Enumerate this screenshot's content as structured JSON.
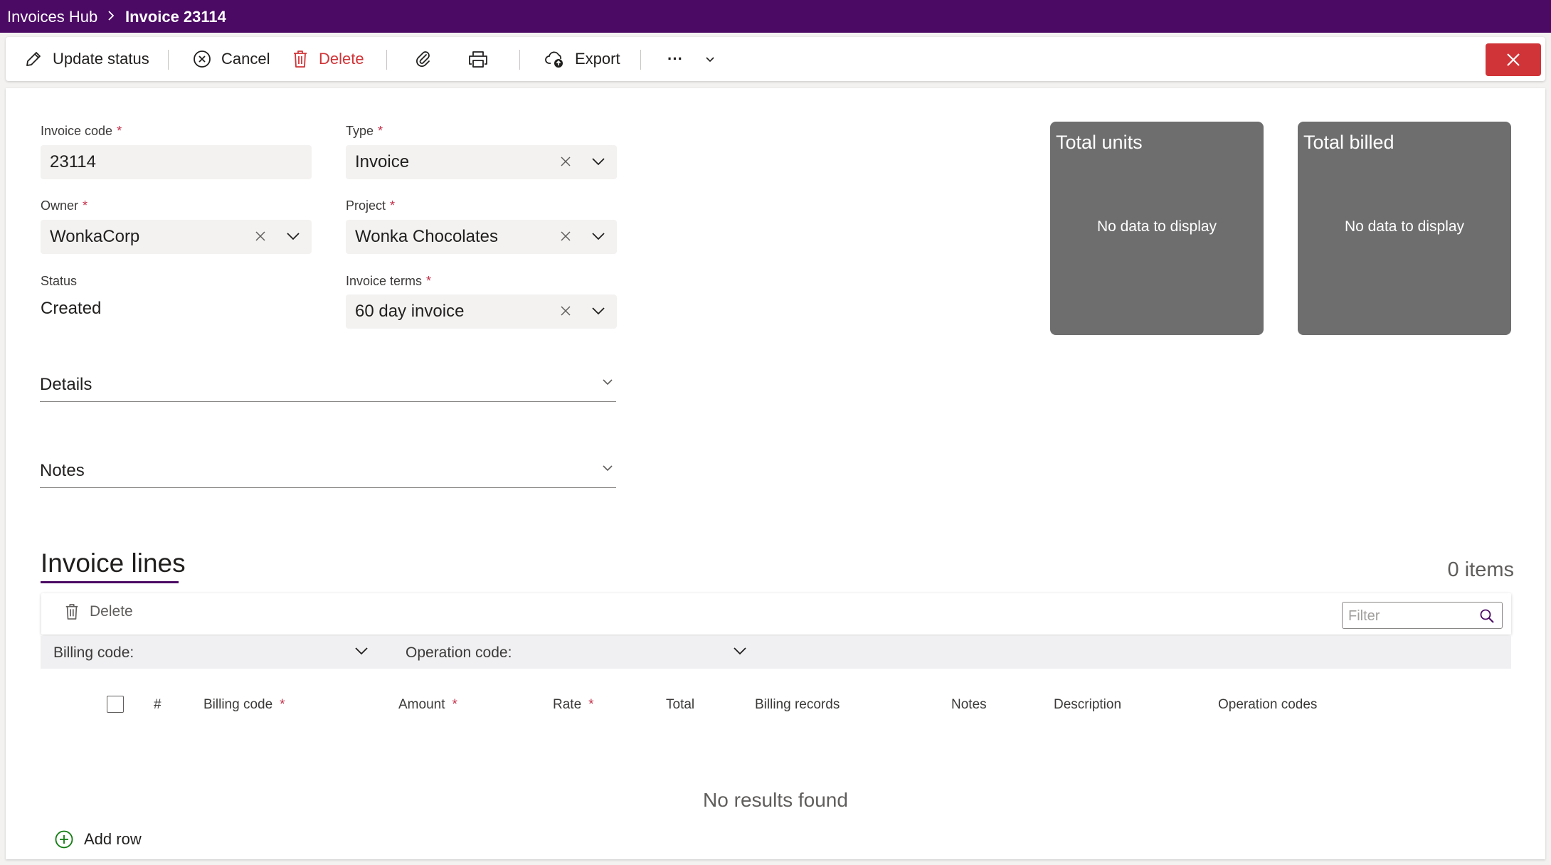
{
  "breadcrumb": {
    "root": "Invoices Hub",
    "current": "Invoice 23114"
  },
  "toolbar": {
    "update_status": "Update status",
    "cancel": "Cancel",
    "delete": "Delete",
    "export": "Export",
    "more": "···"
  },
  "form": {
    "invoice_code": {
      "label": "Invoice code",
      "required": "*",
      "value": "23114"
    },
    "type": {
      "label": "Type",
      "required": "*",
      "value": "Invoice"
    },
    "owner": {
      "label": "Owner",
      "required": "*",
      "value": "WonkaCorp"
    },
    "project": {
      "label": "Project",
      "required": "*",
      "value": "Wonka Chocolates"
    },
    "status": {
      "label": "Status",
      "value": "Created"
    },
    "invoice_terms": {
      "label": "Invoice terms",
      "required": "*",
      "value": "60 day invoice"
    }
  },
  "sections": {
    "details": "Details",
    "notes": "Notes"
  },
  "tiles": [
    {
      "title": "Total units",
      "empty": "No data to display"
    },
    {
      "title": "Total billed",
      "empty": "No data to display"
    }
  ],
  "invoice_lines": {
    "title": "Invoice lines",
    "count": "0 items",
    "delete": "Delete",
    "filter_placeholder": "Filter",
    "filters": {
      "billing_code": "Billing code:",
      "operation_code": "Operation code:"
    },
    "columns": {
      "number": "#",
      "billing_code": "Billing code",
      "amount": "Amount",
      "rate": "Rate",
      "total": "Total",
      "billing_records": "Billing records",
      "notes": "Notes",
      "description": "Description",
      "operation_codes": "Operation codes"
    },
    "required_marker": "*",
    "empty": "No results found",
    "add_row": "Add row"
  },
  "colors": {
    "title_bar": "#4b0a64",
    "danger": "#d13438",
    "required": "#c4314b",
    "tile": "#6e6e6e",
    "add_icon": "#107c10"
  }
}
